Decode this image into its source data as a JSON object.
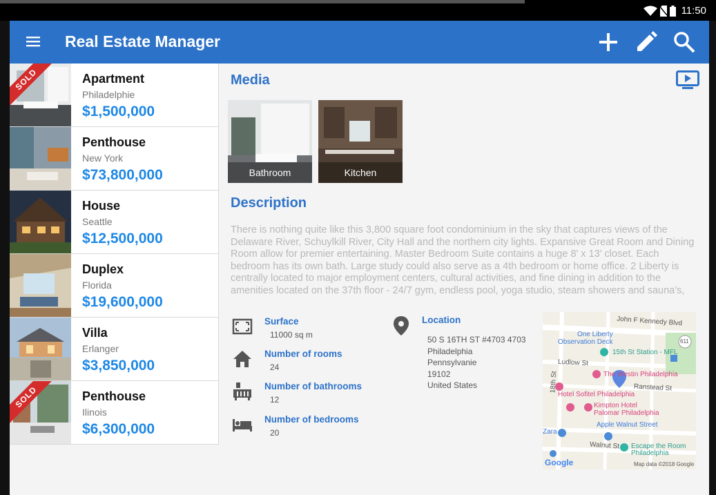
{
  "status": {
    "time": "11:50"
  },
  "appbar": {
    "title": "Real Estate Manager",
    "menu_icon": "menu-icon",
    "actions": [
      "add-icon",
      "edit-icon",
      "search-icon"
    ],
    "color": "#2d72c9"
  },
  "list": {
    "items": [
      {
        "name": "Apartment",
        "city": "Philadelphie",
        "price": "$1,500,000",
        "badge": "SOLD"
      },
      {
        "name": "Penthouse",
        "city": "New York",
        "price": "$73,800,000",
        "badge": ""
      },
      {
        "name": "House",
        "city": "Seattle",
        "price": "$12,500,000",
        "badge": ""
      },
      {
        "name": "Duplex",
        "city": "Florida",
        "price": "$19,600,000",
        "badge": ""
      },
      {
        "name": "Villa",
        "city": "Erlanger",
        "price": "$3,850,000",
        "badge": ""
      },
      {
        "name": "Penthouse",
        "city": "Ilinois",
        "price": "$6,300,000",
        "badge": "SOLD"
      }
    ],
    "price_color": "#1e88e5",
    "sold_color": "#d42b2b"
  },
  "detail": {
    "media_title": "Media",
    "media": [
      {
        "caption": "Bathroom"
      },
      {
        "caption": "Kitchen"
      }
    ],
    "description_title": "Description",
    "description": "There is nothing quite like this 3,800 square foot condominium in the sky that captures views of the Delaware River, Schuylkill River, City Hall and the northern city lights. Expansive Great Room and Dining Room allow for premier entertaining. Master Bedroom Suite contains a huge 8' x 13' closet. Each bedroom has its own bath. Large study could also serve as a 4th bedroom or home office. 2 Liberty is centrally located to major employment centers, cultural activities, and fine dining in addition to the amenities located on the 37th floor - 24/7 gym, endless pool, yoga studio, steam showers and sauna's,",
    "features": [
      {
        "icon": "surface-icon",
        "label": "Surface",
        "value": "11000 sq m"
      },
      {
        "icon": "home-icon",
        "label": "Number of rooms",
        "value": "24"
      },
      {
        "icon": "bathtub-icon",
        "label": "Number of bathrooms",
        "value": "12"
      },
      {
        "icon": "bed-icon",
        "label": "Number of bedrooms",
        "value": "20"
      }
    ],
    "location": {
      "label": "Location",
      "lines": [
        "50 S 16TH ST #4703 4703",
        "Philadelphia",
        "Pennsylvanie",
        "19102",
        "United States"
      ]
    },
    "map": {
      "labels": [
        "John F Kennedy Blvd",
        "One Liberty",
        "Observation Deck",
        "15th St Station - MFL",
        "Ludlow St",
        "The Westin Philadelphia",
        "Ranstead St",
        "Hotel Sofitel Philadelphia",
        "Kimpton Hotel",
        "Palomar Philadelphia",
        "Apple Walnut Street",
        "Zara",
        "Walnut St",
        "Escape the Room",
        "Philadelphia",
        "Map data ©2018 Google",
        "Google",
        "18th St",
        "611"
      ]
    }
  }
}
